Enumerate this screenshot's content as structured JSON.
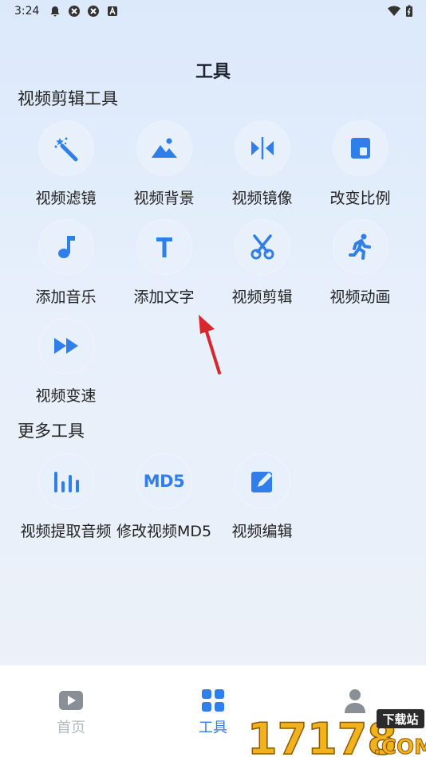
{
  "status_bar": {
    "time": "3:24"
  },
  "page_title": "工具",
  "sections": {
    "video_edit_tools": {
      "title": "视频剪辑工具",
      "items": [
        {
          "label": "视频滤镜",
          "icon": "magic-wand-icon"
        },
        {
          "label": "视频背景",
          "icon": "image-icon"
        },
        {
          "label": "视频镜像",
          "icon": "mirror-icon"
        },
        {
          "label": "改变比例",
          "icon": "aspect-ratio-icon"
        },
        {
          "label": "添加音乐",
          "icon": "music-note-icon"
        },
        {
          "label": "添加文字",
          "icon": "text-icon"
        },
        {
          "label": "视频剪辑",
          "icon": "scissors-icon"
        },
        {
          "label": "视频动画",
          "icon": "running-person-icon"
        },
        {
          "label": "视频变速",
          "icon": "fast-forward-icon"
        }
      ]
    },
    "more_tools": {
      "title": "更多工具",
      "items": [
        {
          "label": "视频提取音频",
          "icon": "audio-bars-icon"
        },
        {
          "label": "修改视频MD5",
          "icon": "md5-icon",
          "icon_text": "MD5"
        },
        {
          "label": "视频编辑",
          "icon": "edit-icon"
        }
      ]
    }
  },
  "bottom_nav": {
    "items": [
      {
        "label": "首页",
        "icon": "play-icon",
        "active": false
      },
      {
        "label": "工具",
        "icon": "grid-icon",
        "active": true
      },
      {
        "label": "",
        "icon": "person-icon",
        "active": false
      }
    ]
  },
  "watermark": {
    "number": "17178",
    "tag": "下载站",
    "suffix": ".COM"
  },
  "colors": {
    "accent": "#2f7ee9",
    "icon_bubble": "#e8f0fb",
    "inactive": "#b4b8bf",
    "arrow": "#d9262c",
    "watermark": "#f2b21e"
  }
}
